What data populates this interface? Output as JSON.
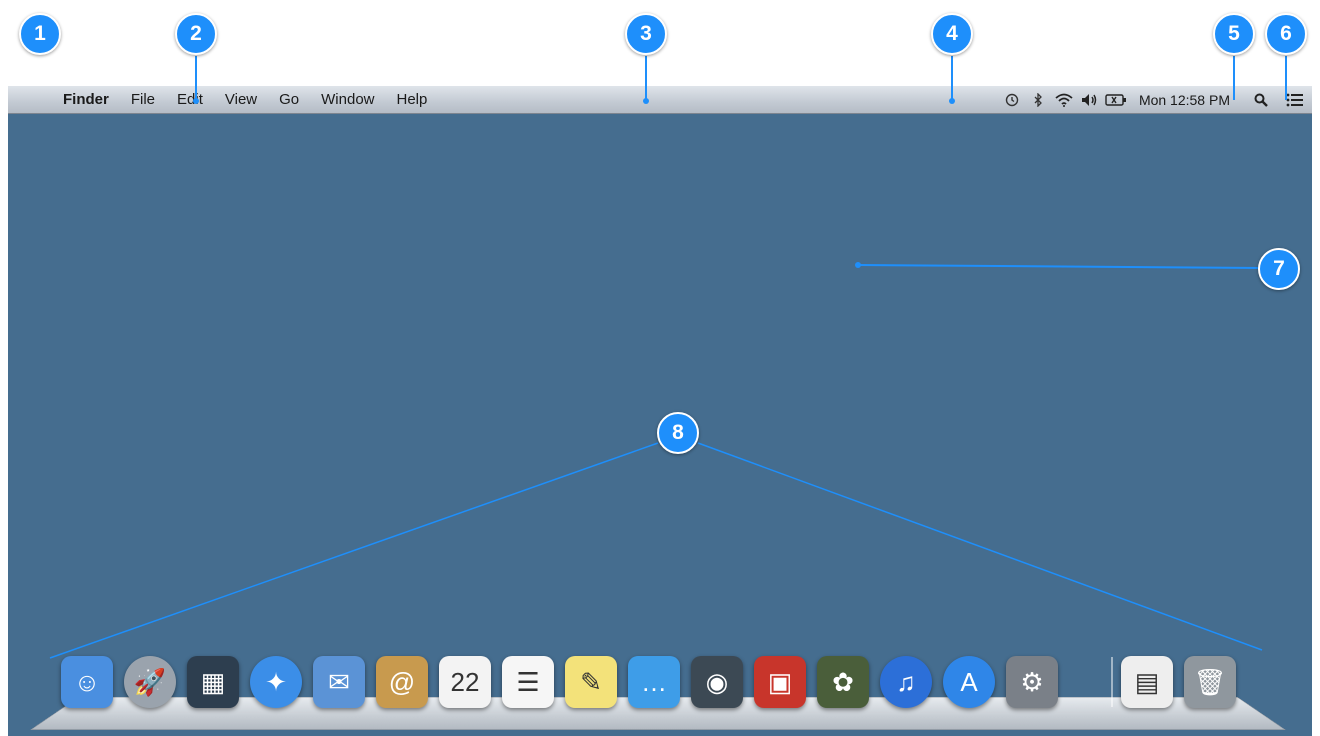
{
  "menubar": {
    "apple_glyph": "",
    "items": [
      {
        "label": "Finder",
        "bold": true
      },
      {
        "label": "File"
      },
      {
        "label": "Edit"
      },
      {
        "label": "View"
      },
      {
        "label": "Go"
      },
      {
        "label": "Window"
      },
      {
        "label": "Help"
      }
    ],
    "status_icons": [
      "time-machine-icon",
      "bluetooth-icon",
      "wifi-icon",
      "volume-icon",
      "battery-icon"
    ],
    "clock": "Mon 12:58 PM"
  },
  "callouts": [
    "1",
    "2",
    "3",
    "4",
    "5",
    "6",
    "7",
    "8"
  ],
  "dock": {
    "apps": [
      {
        "name": "finder-icon",
        "glyph": "☺",
        "bg": "#4a8fe0"
      },
      {
        "name": "launchpad-icon",
        "glyph": "🚀",
        "bg": "#9aa3ad"
      },
      {
        "name": "mission-control-icon",
        "glyph": "▦",
        "bg": "#2d3e4f"
      },
      {
        "name": "safari-icon",
        "glyph": "✦",
        "bg": "#3b8ee8"
      },
      {
        "name": "mail-icon",
        "glyph": "✉",
        "bg": "#5b93d6"
      },
      {
        "name": "contacts-icon",
        "glyph": "@",
        "bg": "#c89a4e"
      },
      {
        "name": "calendar-icon",
        "glyph": "22",
        "bg": "#f3f3f3"
      },
      {
        "name": "reminders-icon",
        "glyph": "☰",
        "bg": "#f6f6f6"
      },
      {
        "name": "notes-icon",
        "glyph": "✎",
        "bg": "#f3e27a"
      },
      {
        "name": "messages-icon",
        "glyph": "…",
        "bg": "#3e9de8"
      },
      {
        "name": "facetime-icon",
        "glyph": "◉",
        "bg": "#3c4954"
      },
      {
        "name": "photo-booth-icon",
        "glyph": "▣",
        "bg": "#c8352b"
      },
      {
        "name": "iphoto-icon",
        "glyph": "✿",
        "bg": "#4a5e3a"
      },
      {
        "name": "itunes-icon",
        "glyph": "♫",
        "bg": "#2c6fd8"
      },
      {
        "name": "app-store-icon",
        "glyph": "A",
        "bg": "#2f86e8"
      },
      {
        "name": "system-preferences-icon",
        "glyph": "⚙",
        "bg": "#7a8088"
      }
    ],
    "right_items": [
      {
        "name": "documents-stack-icon",
        "glyph": "▤",
        "bg": "#eeeeee"
      },
      {
        "name": "trash-icon",
        "glyph": "🗑",
        "bg": "#8f979e"
      }
    ]
  }
}
